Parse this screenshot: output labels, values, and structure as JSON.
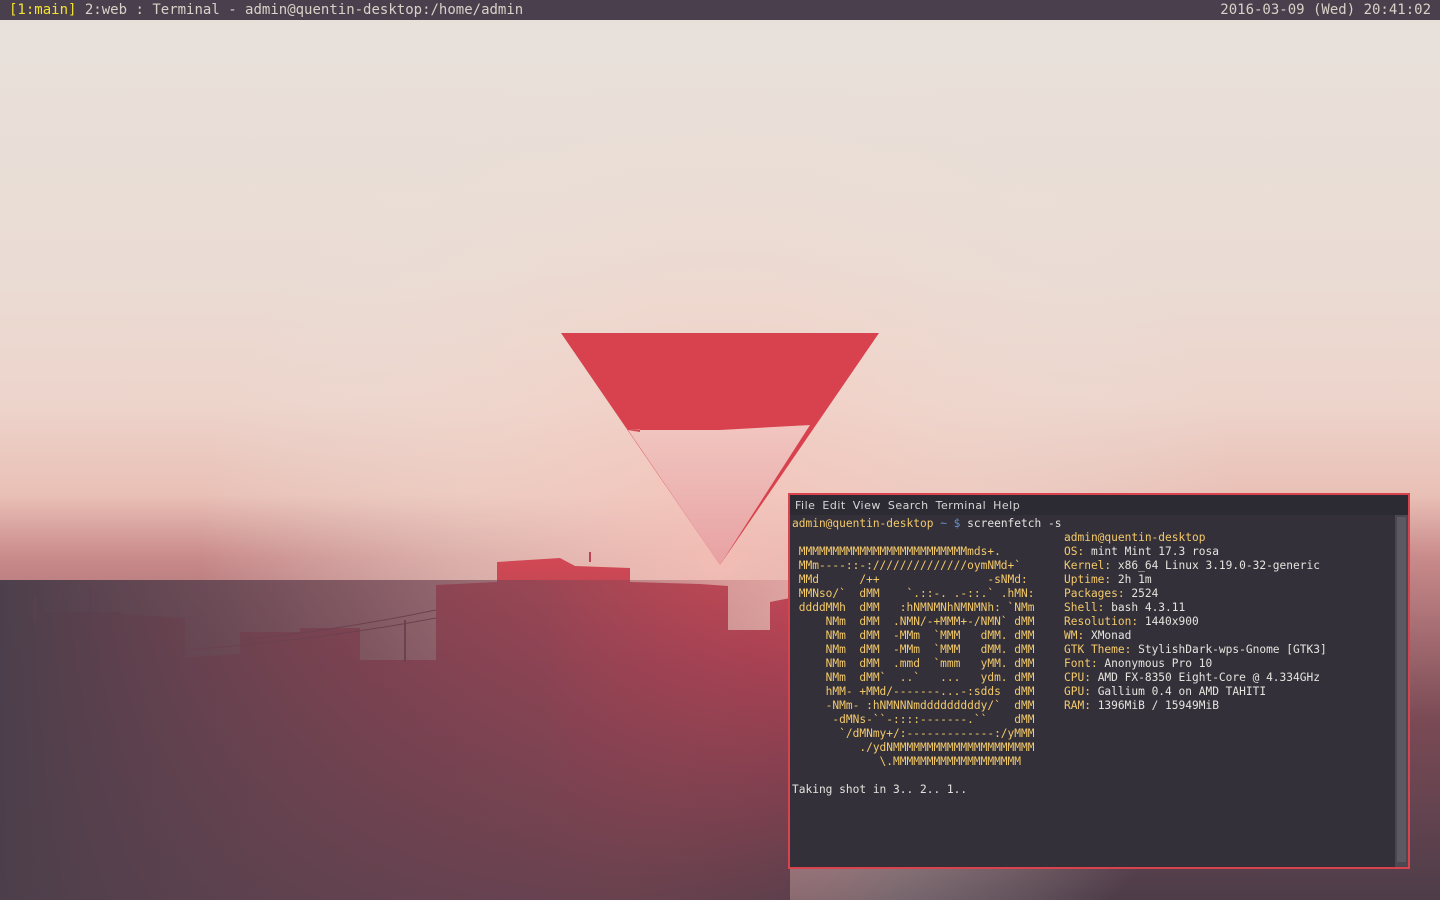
{
  "topbar": {
    "workspace_active": "[1:main]",
    "workspace_other": "2:web",
    "separator": ":",
    "window_title": "Terminal - admin@quentin-desktop:/home/admin",
    "datetime": "2016-03-09 (Wed) 20:41:02"
  },
  "terminal": {
    "menu": [
      "File",
      "Edit",
      "View",
      "Search",
      "Terminal",
      "Help"
    ],
    "prompt_user": "admin@quentin-desktop",
    "prompt_path": " ~ $",
    "command": " screenfetch -s",
    "ascii_art": [
      " MMMMMMMMMMMMMMMMMMMMMMMMMmds+.",
      " MMm----::-://////////////oymNMd+`",
      " MMd      /++                -sNMd:",
      " MMNso/`  dMM    `.::-. .-::.` .hMN:",
      " ddddMMh  dMM   :hNMNMNhNMNMNh: `NMm",
      "     NMm  dMM  .NMN/-+MMM+-/NMN` dMM",
      "     NMm  dMM  -MMm  `MMM   dMM. dMM",
      "     NMm  dMM  -MMm  `MMM   dMM. dMM",
      "     NMm  dMM  .mmd  `mmm   yMM. dMM",
      "     NMm  dMM`  ..`   ...   ydm. dMM",
      "     hMM- +MMd/-------...-:sdds  dMM",
      "     -NMm- :hNMNNNmdddddddddy/`  dMM",
      "      -dMNs-``-::::-------.``    dMM",
      "       `/dMNmy+/:-------------:/yMMM",
      "          ./ydNMMMMMMMMMMMMMMMMMMMMM",
      "             \\.MMMMMMMMMMMMMMMMMMM"
    ],
    "info_header": "admin@quentin-desktop",
    "info": [
      {
        "key": "OS:",
        "value": " mint Mint 17.3 rosa"
      },
      {
        "key": "Kernel:",
        "value": " x86_64 Linux 3.19.0-32-generic"
      },
      {
        "key": "Uptime:",
        "value": " 2h 1m"
      },
      {
        "key": "Packages:",
        "value": " 2524"
      },
      {
        "key": "Shell:",
        "value": " bash 4.3.11"
      },
      {
        "key": "Resolution:",
        "value": " 1440x900"
      },
      {
        "key": "WM:",
        "value": " XMonad"
      },
      {
        "key": "GTK Theme:",
        "value": " StylishDark-wps-Gnome [GTK3]"
      },
      {
        "key": "Font:",
        "value": " Anonymous Pro 10"
      },
      {
        "key": "CPU:",
        "value": " AMD FX-8350 Eight-Core @ 4.334GHz"
      },
      {
        "key": "GPU:",
        "value": " Gallium 0.4 on AMD TAHITI"
      },
      {
        "key": "RAM:",
        "value": " 1396MiB / 15949MiB"
      }
    ],
    "countdown": "Taking shot in 3.. 2.. 1.."
  },
  "colors": {
    "bar_bg": "#4a3f4d",
    "workspace_active": "#f2e22f",
    "terminal_border": "#d8434d",
    "terminal_bg": "#333039",
    "accent_yellow": "#f3c96a",
    "prompt_blue": "#6b91c7"
  }
}
